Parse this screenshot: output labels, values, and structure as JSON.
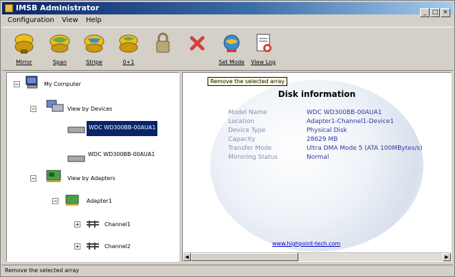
{
  "window": {
    "title": "IMSB Administrator",
    "buttons": [
      "_",
      "□",
      "×"
    ]
  },
  "menu": [
    "Configuration",
    "View",
    "Help"
  ],
  "toolbar": [
    {
      "label": "Mirror",
      "icon": "mirror-icon"
    },
    {
      "label": "Span",
      "icon": "span-icon"
    },
    {
      "label": "Stripe",
      "icon": "stripe-icon"
    },
    {
      "label": "0+1",
      "icon": "raid01-icon"
    },
    {
      "label": "",
      "icon": "lock-icon"
    },
    {
      "label": "",
      "icon": "remove-icon"
    },
    {
      "label": "Set Mode",
      "icon": "set-mode-icon"
    },
    {
      "label": "View Log",
      "icon": "view-log-icon"
    }
  ],
  "tree": {
    "root": "My Computer",
    "by_devices": "View by Devices",
    "devices": [
      "WDC WD300BB-00AUA1",
      "WDC WD300BB-00AUA1"
    ],
    "by_adapters": "View by Adapters",
    "adapter": "Adapter1",
    "channels": [
      "Channel1",
      "Channel2"
    ],
    "toggle_minus": "−",
    "toggle_plus": "+"
  },
  "tooltip": "Remove the selected array",
  "detail": {
    "title": "Disk information",
    "rows": [
      {
        "key": "Model Name",
        "value": "WDC WD300BB-00AUA1"
      },
      {
        "key": "Location",
        "value": "Adapter1-Channel1-Device1"
      },
      {
        "key": "Device Type",
        "value": "Physical Disk"
      },
      {
        "key": "Capacity",
        "value": "28629 MB"
      },
      {
        "key": "Transfer Mode",
        "value": "Ultra DMA Mode 5 (ATA 100MBytes/s)"
      },
      {
        "key": "Mirroring Status",
        "value": "Normal"
      }
    ],
    "link": "www.highpoint-tech.com"
  },
  "status": "Remove the selected array"
}
